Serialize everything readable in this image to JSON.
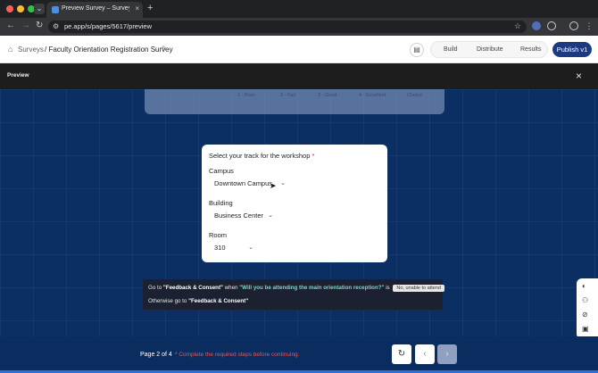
{
  "browser": {
    "tab_title": "Preview Survey – Survey Eve",
    "tab_close": "×",
    "new_tab": "+",
    "tab_menu": "⌄",
    "url": "pe.app/s/pages/5617/preview",
    "nav": {
      "back": "←",
      "forward": "→",
      "reload": "↻"
    },
    "icons": [
      "tune-icon",
      "star-icon",
      "extension-icon",
      "puzzle-icon",
      "profile-icon",
      "more-icon"
    ]
  },
  "header": {
    "breadcrumb_root": "Surveys",
    "breadcrumb_title": "/ Faculty Orientation Registration Survey",
    "tabs": [
      "Build",
      "Distribute",
      "Results"
    ],
    "publish_label": "Publish v1"
  },
  "preview": {
    "label": "Preview",
    "close": "×"
  },
  "previous_question": {
    "scale": [
      "1 - Poor",
      "2 - Fair",
      "3 - Good",
      "4 - Excellent",
      "Choice"
    ]
  },
  "question": {
    "prompt": "Select your track for the workshop",
    "required_mark": "*",
    "fields": [
      {
        "label": "Campus",
        "value": "Downtown Campus"
      },
      {
        "label": "Building",
        "value": "Business Center"
      },
      {
        "label": "Room",
        "value": "310"
      }
    ]
  },
  "logic": {
    "line1_prefix": "Go to",
    "line1_target": "\"Feedback & Consent\"",
    "line1_when": "when",
    "line1_question": "\"Will you be attending the main orientation reception?\"",
    "line1_is": "is",
    "line1_answer": "No, unable to attend",
    "line2_prefix": "Otherwise go to",
    "line2_target": "\"Feedback & Consent\""
  },
  "footer": {
    "page_label": "Page 2 of 4",
    "required_message": "* Complete the required steps before continuing.",
    "refresh": "↻",
    "prev": "‹",
    "next": "›"
  },
  "colors": {
    "canvas_bg": "#0c2f63",
    "publish_bg": "#1c3a82",
    "required": "#d32f2f",
    "logic_highlight": "#7fd3c8"
  }
}
